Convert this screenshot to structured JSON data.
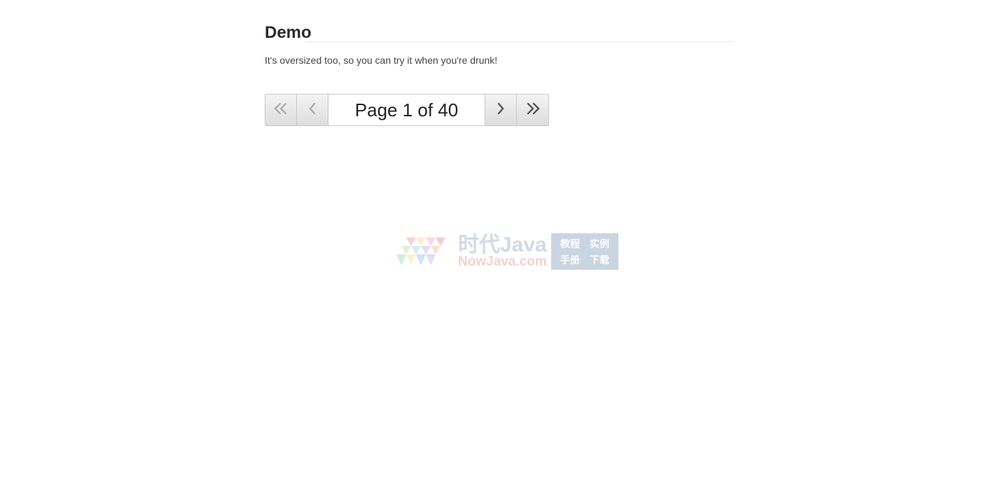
{
  "header": {
    "title": "Demo",
    "subtitle": "It's oversized too, so you can try it when you're drunk!"
  },
  "pager": {
    "first_icon": "double-chevron-left-icon",
    "prev_icon": "chevron-left-icon",
    "next_icon": "chevron-right-icon",
    "last_icon": "double-chevron-right-icon",
    "value": "Page 1 of 40",
    "current_page": 1,
    "total_pages": 40
  },
  "watermark": {
    "brand": "时代Java",
    "domain": "NowJava.com",
    "tags": [
      "教程",
      "实例",
      "手册",
      "下载"
    ]
  }
}
